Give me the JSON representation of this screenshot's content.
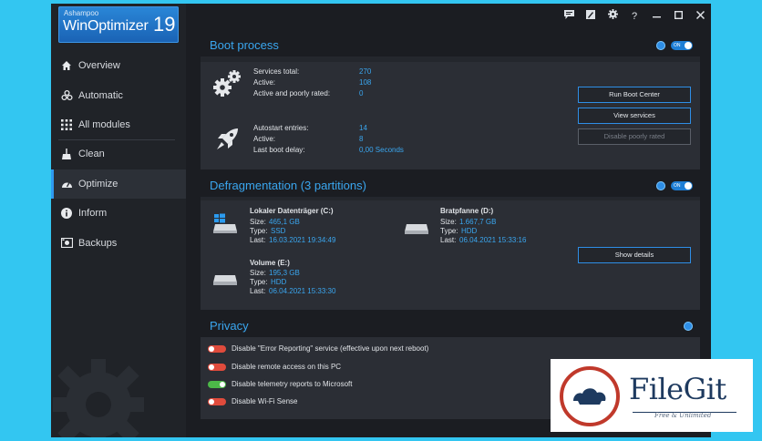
{
  "app": {
    "brand": "Ashampoo",
    "name": "WinOptimizer",
    "version": "19"
  },
  "sidebar": {
    "items": [
      {
        "label": "Overview",
        "icon": "home-icon"
      },
      {
        "label": "Automatic",
        "icon": "automatic-icon"
      },
      {
        "label": "All modules",
        "icon": "grid-icon"
      },
      {
        "label": "Clean",
        "icon": "broom-icon"
      },
      {
        "label": "Optimize",
        "icon": "speedometer-icon",
        "active": true
      },
      {
        "label": "Inform",
        "icon": "info-icon"
      },
      {
        "label": "Backups",
        "icon": "backup-icon"
      }
    ]
  },
  "titlebar": [
    "chat-icon",
    "edit-icon",
    "gear-icon",
    "help-icon",
    "minimize-icon",
    "maximize-icon",
    "close-icon"
  ],
  "boot": {
    "title": "Boot process",
    "toggle": "ON",
    "services": [
      {
        "label": "Services total:",
        "value": "270"
      },
      {
        "label": "Active:",
        "value": "108"
      },
      {
        "label": "Active and poorly rated:",
        "value": "0"
      }
    ],
    "autostart": [
      {
        "label": "Autostart entries:",
        "value": "14"
      },
      {
        "label": "Active:",
        "value": "8"
      },
      {
        "label": "Last boot delay:",
        "value": "0,00 Seconds"
      }
    ],
    "buttons": {
      "run": "Run Boot Center",
      "view": "View services",
      "disable": "Disable poorly rated"
    }
  },
  "defrag": {
    "title": "Defragmentation (3 partitions)",
    "toggle": "ON",
    "drives": [
      {
        "name": "Lokaler Datenträger (C:)",
        "size": "465,1 GB",
        "type": "SSD",
        "last": "16.03.2021 19:34:49"
      },
      {
        "name": "Bratpfanne (D:)",
        "size": "1.667,7 GB",
        "type": "HDD",
        "last": "06.04.2021 15:33:16"
      },
      {
        "name": "Volume (E:)",
        "size": "195,3 GB",
        "type": "HDD",
        "last": "06.04.2021 15:33:30"
      }
    ],
    "labels": {
      "size": "Size:",
      "type": "Type:",
      "last": "Last:"
    },
    "details_button": "Show details"
  },
  "privacy": {
    "title": "Privacy",
    "items": [
      {
        "label": "Disable \"Error Reporting\" service (effective upon next reboot)",
        "state": "off"
      },
      {
        "label": "Disable remote access on this PC",
        "state": "off"
      },
      {
        "label": "Disable telemetry reports to Microsoft",
        "state": "on"
      },
      {
        "label": "Disable Wi-Fi Sense",
        "state": "off"
      }
    ]
  },
  "watermark": {
    "name": "FileGit",
    "tagline": "Free & Unlimited"
  },
  "colors": {
    "accent": "#3aa6ef",
    "background": "#33c6f1",
    "off": "#e04b3c",
    "on": "#4cb848"
  }
}
